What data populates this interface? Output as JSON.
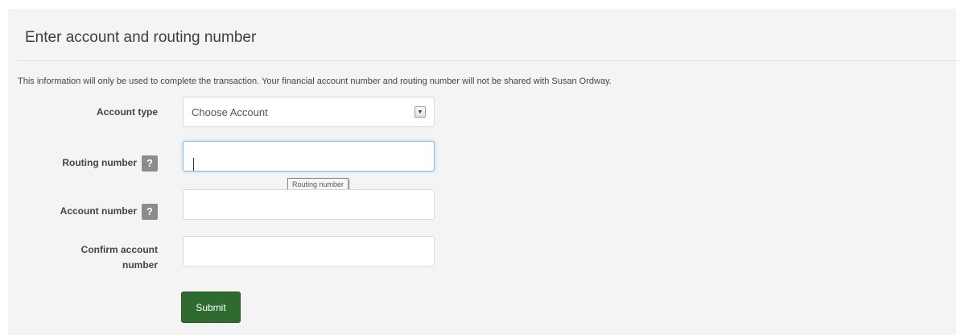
{
  "form": {
    "title": "Enter account and routing number",
    "info_text": "This information will only be used to complete the transaction. Your financial account number and routing number will not be shared with Susan Ordway.",
    "account_type": {
      "label": "Account type",
      "selected": "Choose Account"
    },
    "routing_number": {
      "label": "Routing number",
      "help": "?",
      "value": "",
      "tooltip": "Routing number"
    },
    "account_number": {
      "label": "Account number",
      "help": "?",
      "value": ""
    },
    "confirm_account_number": {
      "label_line1": "Confirm account",
      "label_line2": "number",
      "value": ""
    },
    "submit_label": "Submit"
  },
  "colors": {
    "panel_background": "#f4f4f4",
    "submit_background": "#2f6b2f",
    "focus_border": "#8fb8d9",
    "help_icon": "#8c8c8c"
  }
}
